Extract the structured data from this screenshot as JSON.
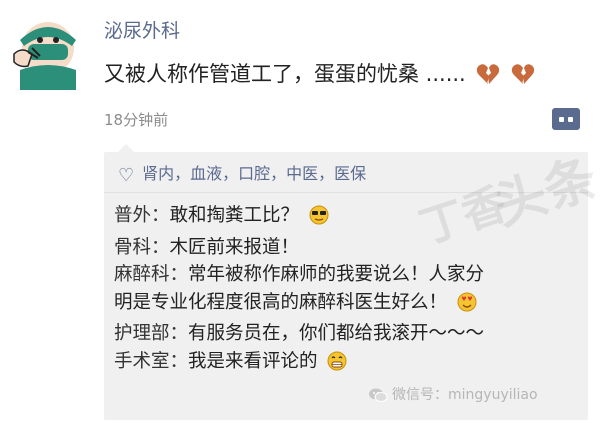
{
  "post": {
    "username": "泌尿外科",
    "text": "又被人称作管道工了，蛋蛋的忧桑 ......",
    "timestamp": "18分钟前"
  },
  "likes": {
    "names": "肾内，血液，口腔，中医，医保"
  },
  "comments": [
    {
      "dept": "普外：",
      "text": "敢和掏粪工比？",
      "emoji": "sunglasses-face-icon"
    },
    {
      "dept": "骨科：",
      "text": "木匠前来报道！",
      "emoji": ""
    },
    {
      "dept": "麻醉科：",
      "text": "常年被称作麻师的我要说么！人家分",
      "emoji": ""
    },
    {
      "dept": "",
      "text": "明是专业化程度很高的麻醉科医生好么！",
      "emoji": "heart-eyes-face-icon"
    },
    {
      "dept": "护理部：",
      "text": "有服务员在，你们都给我滚开～～～",
      "emoji": ""
    },
    {
      "dept": "手术室：",
      "text": "我是来看评论的",
      "emoji": "grinning-face-icon"
    }
  ],
  "watermark": {
    "text": "微信号：mingyuyiliao"
  },
  "colors": {
    "link_blue": "#5b6a8f",
    "comment_bg": "#f0f0f0"
  }
}
